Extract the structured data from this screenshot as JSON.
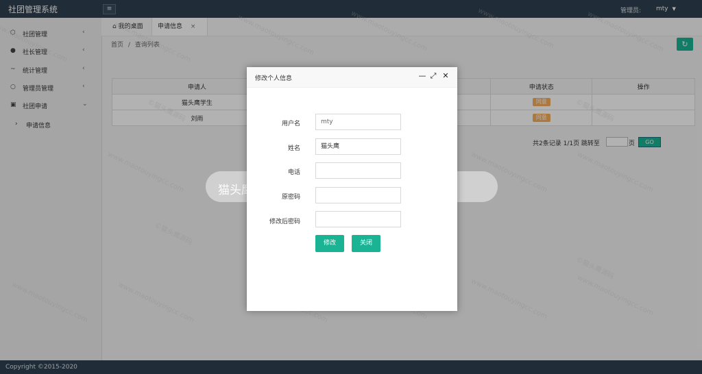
{
  "app": {
    "title": "社团管理系统"
  },
  "header": {
    "menu_toggle_icon": "menu-icon",
    "admin_label": "管理员:",
    "user_name": "mty",
    "user_caret": "▼"
  },
  "sidebar": {
    "items": [
      {
        "label": "社团管理",
        "icon": "cube-icon",
        "chevron": "‹"
      },
      {
        "label": "社长管理",
        "icon": "person-icon",
        "chevron": "‹"
      },
      {
        "label": "统计管理",
        "icon": "pulse-icon",
        "chevron": "‹"
      },
      {
        "label": "管理员管理",
        "icon": "user-icon",
        "chevron": "‹"
      },
      {
        "label": "社团申请",
        "icon": "calendar-icon",
        "chevron": "⌄"
      }
    ],
    "sub_item": {
      "label": "申请信息",
      "dot": "›"
    }
  },
  "tabs": [
    {
      "label": "我的桌面",
      "icon": "home-icon"
    },
    {
      "label": "申请信息",
      "close": "×"
    }
  ],
  "breadcrumb": {
    "home": "首页",
    "separator": "/",
    "current": "查询列表"
  },
  "toolbar": {
    "refresh_icon": "refresh-icon",
    "refresh_glyph": "↻"
  },
  "table": {
    "columns": [
      "申请人",
      "",
      "",
      "",
      "申请状态",
      "操作"
    ],
    "rows": [
      {
        "applicant": "猫头鹰学生",
        "status": "同意",
        "action": ""
      },
      {
        "applicant": "刘雨",
        "status": "同意",
        "action": ""
      }
    ]
  },
  "pagination": {
    "summary": "共2条记录  1/1页  跳转至",
    "page_suffix": "页",
    "go_label": "GO",
    "page_value": ""
  },
  "modal": {
    "title": "修改个人信息",
    "window_controls": [
      "—",
      "⤢",
      "✕"
    ],
    "fields": [
      {
        "label": "用户名",
        "value": "mty",
        "placeholder": ""
      },
      {
        "label": "姓名",
        "value": "猫头鹰",
        "placeholder": ""
      },
      {
        "label": "电话",
        "value": "",
        "placeholder": ""
      },
      {
        "label": "原密码",
        "value": "",
        "placeholder": ""
      },
      {
        "label": "修改后密码",
        "value": "",
        "placeholder": ""
      }
    ],
    "buttons": {
      "submit": "修改",
      "close": "关闭"
    }
  },
  "watermark": {
    "line1": "©猫头鹰源码",
    "line2": "www.maotouyingcc.com"
  },
  "banner": {
    "text": "猫头鹰源码 maotouyingcc.com"
  },
  "footer": {
    "copyright": "Copyright ©2015-2020"
  }
}
